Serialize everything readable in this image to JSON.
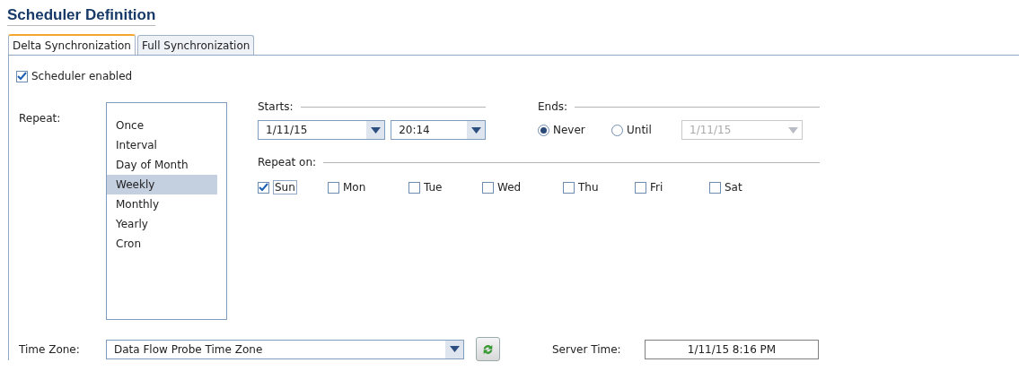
{
  "title": "Scheduler Definition",
  "tabs": [
    {
      "label": "Delta Synchronization",
      "selected": true
    },
    {
      "label": "Full Synchronization",
      "selected": false
    }
  ],
  "scheduler_enabled": {
    "label": "Scheduler enabled",
    "checked": true
  },
  "repeat": {
    "label": "Repeat:",
    "options": [
      {
        "label": "Once",
        "selected": false
      },
      {
        "label": "Interval",
        "selected": false
      },
      {
        "label": "Day of Month",
        "selected": false
      },
      {
        "label": "Weekly",
        "selected": true
      },
      {
        "label": "Monthly",
        "selected": false
      },
      {
        "label": "Yearly",
        "selected": false
      },
      {
        "label": "Cron",
        "selected": false
      }
    ]
  },
  "starts": {
    "label": "Starts:",
    "date": "1/11/15",
    "time": "20:14"
  },
  "ends": {
    "label": "Ends:",
    "options": [
      {
        "label": "Never",
        "selected": true
      },
      {
        "label": "Until",
        "selected": false
      }
    ],
    "until_date": "1/11/15",
    "until_disabled": true
  },
  "repeat_on": {
    "label": "Repeat on:",
    "days": [
      {
        "label": "Sun",
        "checked": true
      },
      {
        "label": "Mon",
        "checked": false
      },
      {
        "label": "Tue",
        "checked": false
      },
      {
        "label": "Wed",
        "checked": false
      },
      {
        "label": "Thu",
        "checked": false
      },
      {
        "label": "Fri",
        "checked": false
      },
      {
        "label": "Sat",
        "checked": false
      }
    ]
  },
  "time_zone": {
    "label": "Time Zone:",
    "value": "Data Flow Probe Time Zone"
  },
  "server_time": {
    "label": "Server Time:",
    "value": "1/11/15 8:16 PM"
  }
}
